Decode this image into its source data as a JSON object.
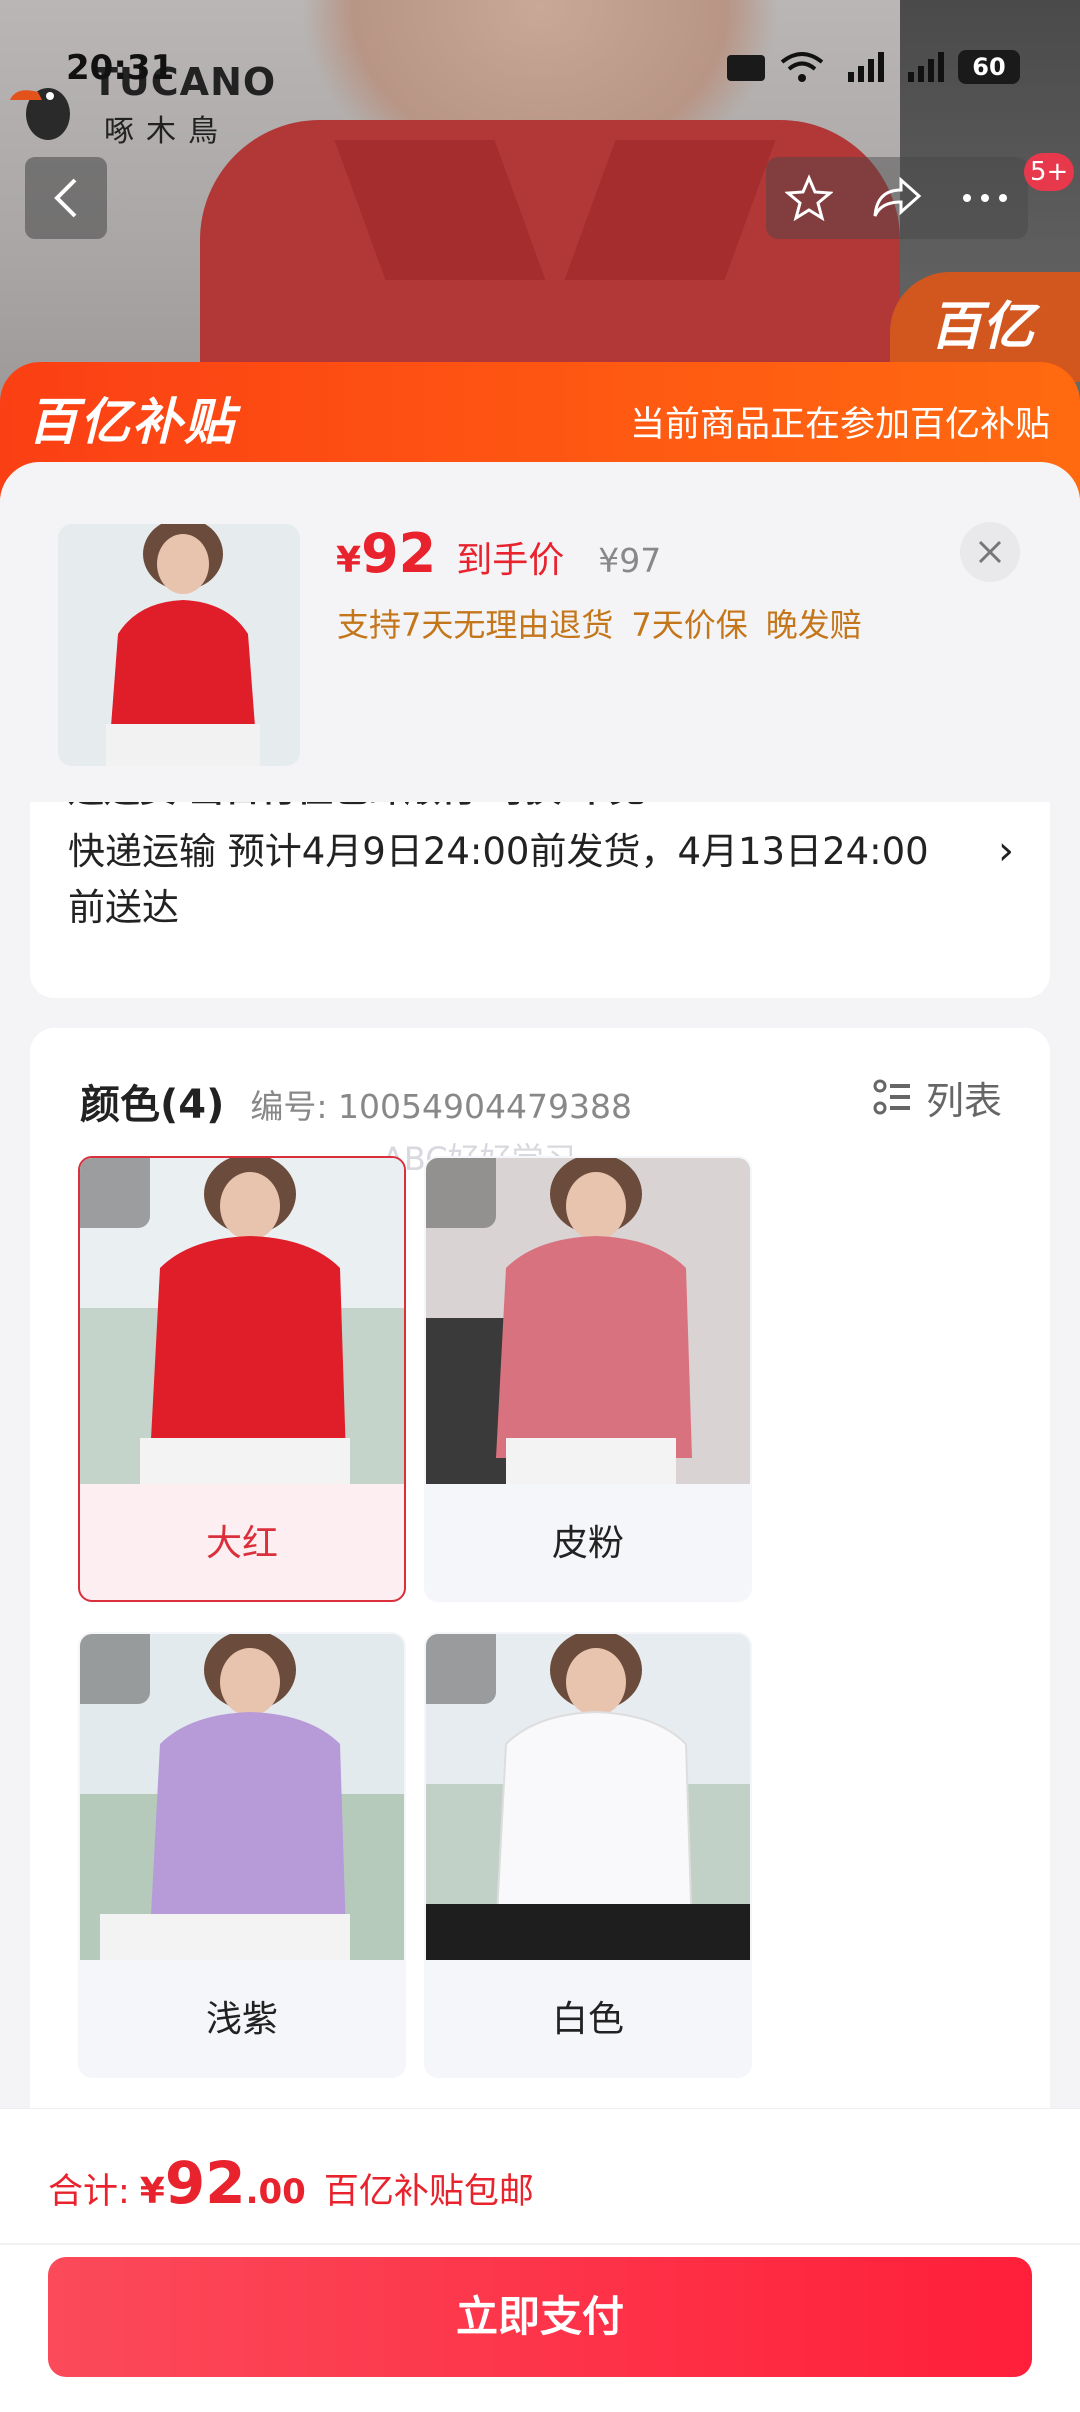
{
  "status_bar": {
    "time": "20:31",
    "battery": "60"
  },
  "brand": {
    "name_en": "TUCANO",
    "name_cn": "啄木鳥"
  },
  "badge": {
    "count": "5+"
  },
  "banner": {
    "logo_text": "百亿补贴",
    "note": "当前商品正在参加百亿补贴",
    "corner_logo": "百亿"
  },
  "product": {
    "price_symbol": "¥",
    "price": "92",
    "price_tag": "到手价",
    "original_price": "¥97",
    "services": [
      "支持7天无理由退货",
      "7天价保",
      "晚发赔"
    ]
  },
  "delivery": {
    "cut_text": "运运费 当日付但包邮顺付 可换 不见",
    "text": "快递运输 预计4月9日24:00前发货，4月13日24:00前送达"
  },
  "colors": {
    "title": "颜色(4)",
    "sku": "编号: 10054904479388",
    "list_label": "列表",
    "watermark": "ABC好好学习",
    "options": [
      {
        "label": "大红",
        "color": "#e01e2a",
        "selected": true
      },
      {
        "label": "皮粉",
        "color": "#d9727f",
        "selected": false
      },
      {
        "label": "浅紫",
        "color": "#b79bd8",
        "selected": false
      },
      {
        "label": "白色",
        "color": "#f7f7f9",
        "selected": false
      }
    ]
  },
  "footer": {
    "total_label": "合计:",
    "total_yen": "¥",
    "total_int": "92",
    "total_dec": ".00",
    "total_note": "百亿补贴包邮",
    "pay_label": "立即支付"
  },
  "colors_theme": {
    "accent": "#e8232d",
    "banner": "#fb3f14",
    "service": "#c4761a"
  }
}
